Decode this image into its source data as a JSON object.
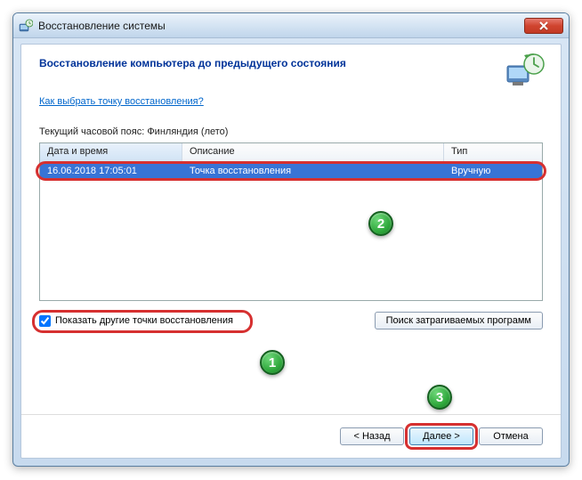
{
  "window": {
    "title": "Восстановление системы"
  },
  "page": {
    "heading": "Восстановление компьютера до предыдущего состояния",
    "helpLink": "Как выбрать точку восстановления?",
    "timezone": "Текущий часовой пояс: Финляндия (лето)"
  },
  "table": {
    "headers": {
      "datetime": "Дата и время",
      "description": "Описание",
      "type": "Тип"
    },
    "rows": [
      {
        "datetime": "16.06.2018 17:05:01",
        "description": "Точка восстановления",
        "type": "Вручную"
      }
    ]
  },
  "controls": {
    "showOther": "Показать другие точки восстановления",
    "scanAffected": "Поиск затрагиваемых программ"
  },
  "wizard": {
    "back": "< Назад",
    "next": "Далее >",
    "cancel": "Отмена"
  },
  "markers": {
    "m1": "1",
    "m2": "2",
    "m3": "3"
  }
}
